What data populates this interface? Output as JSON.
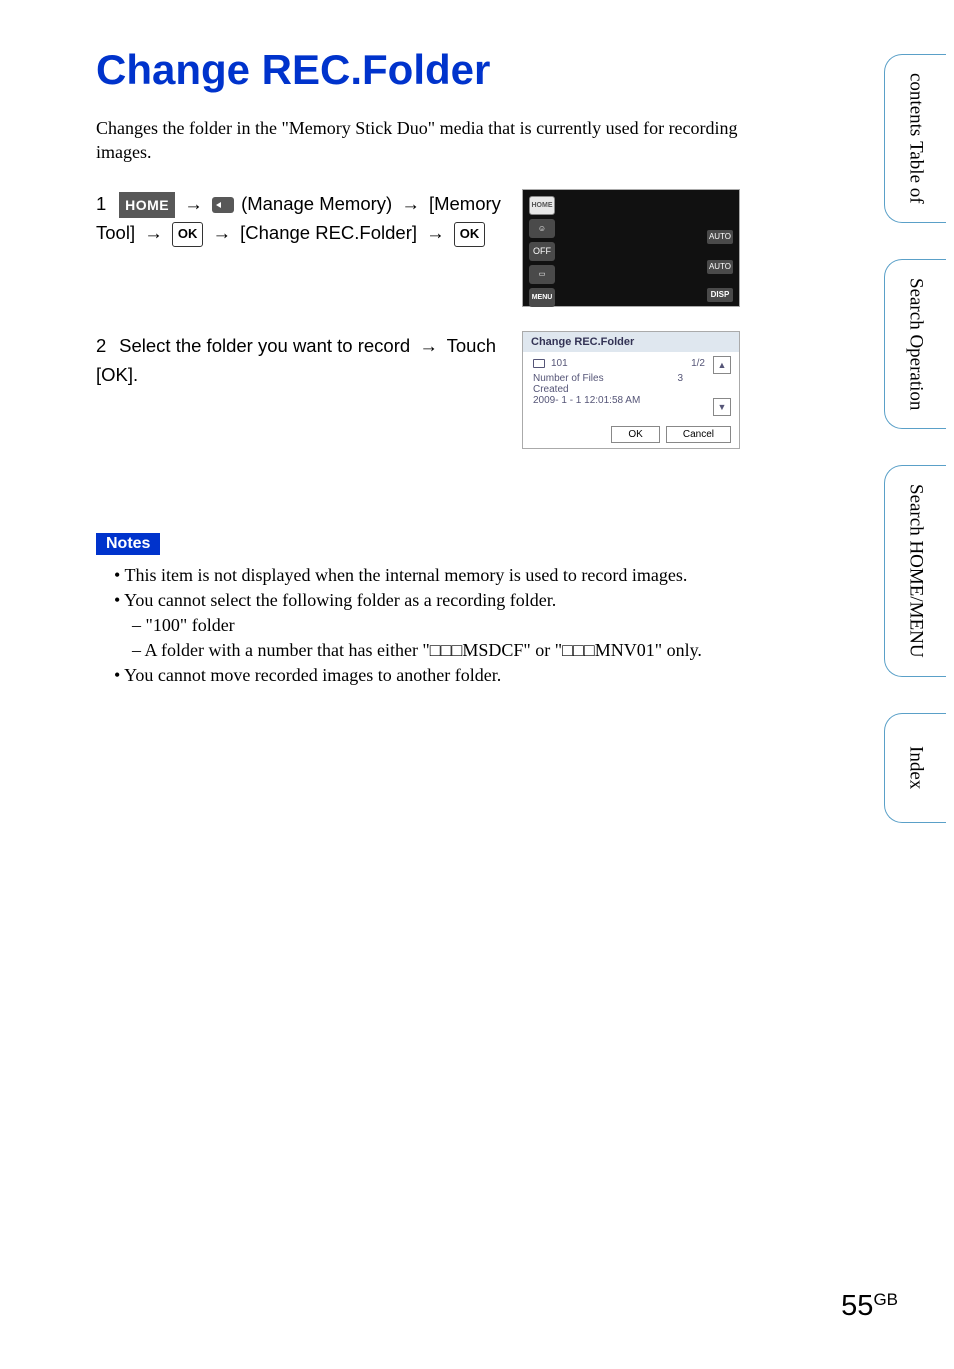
{
  "page_title": "Change REC.Folder",
  "intro": "Changes the folder in the \"Memory Stick Duo\" media that is currently used for recording images.",
  "steps": {
    "s1": {
      "num": "1",
      "home_label": "HOME",
      "text_a": " (Manage Memory) ",
      "text_b": " [Memory Tool] ",
      "ok_label": "OK",
      "text_c": " [Change REC.Folder] "
    },
    "s2": {
      "num": "2",
      "text_a": "Select the folder you want to record ",
      "text_b": " Touch [OK]."
    }
  },
  "lcd_upper": {
    "home": "HOME",
    "menu": "MENU",
    "off": "OFF",
    "disp": "DISP",
    "auto1": "AUTO",
    "auto2": "AUTO"
  },
  "lcd_lower": {
    "title": "Change REC.Folder",
    "folder_num": "101",
    "page": "1/2",
    "files_label": "Number of Files",
    "files_val": "3",
    "created_label": "Created",
    "created_val": "2009- 1 - 1 12:01:58 AM",
    "ok": "OK",
    "cancel": "Cancel"
  },
  "notes": {
    "label": "Notes",
    "n1": "This item is not displayed when the internal memory is used to record images.",
    "n2": "You cannot select the following folder as a recording folder.",
    "n2a": "\"100\" folder",
    "n2b": "A folder with a number that has either \"□□□MSDCF\" or \"□□□MNV01\" only.",
    "n3": "You cannot move recorded images to another folder."
  },
  "tabs": {
    "t1a": "Table of",
    "t1b": "contents",
    "t2a": "Operation",
    "t2b": "Search",
    "t3a": "HOME/MENU",
    "t3b": "Search",
    "t4": "Index"
  },
  "footer": {
    "page": "55",
    "suffix": "GB"
  }
}
